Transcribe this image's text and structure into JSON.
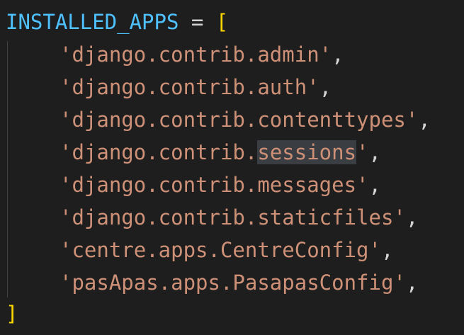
{
  "colors": {
    "background": "#1e1e1e",
    "variable": "#4fc1ff",
    "operator": "#d4d4d4",
    "bracket": "#ffd700",
    "string": "#ce9178",
    "selection_highlight": "#3a3d41"
  },
  "code": {
    "variable": "INSTALLED_APPS",
    "assign": " = ",
    "open_bracket": "[",
    "close_bracket": "]",
    "comma": ",",
    "entries": [
      "'django.contrib.admin'",
      "'django.contrib.auth'",
      "'django.contrib.contenttypes'",
      "'django.contrib.",
      "'django.contrib.messages'",
      "'django.contrib.staticfiles'",
      "'centre.apps.CentreConfig'",
      "'pasApas.apps.PasapasConfig'"
    ],
    "highlighted_word": "sessions",
    "highlighted_tail": "'"
  }
}
